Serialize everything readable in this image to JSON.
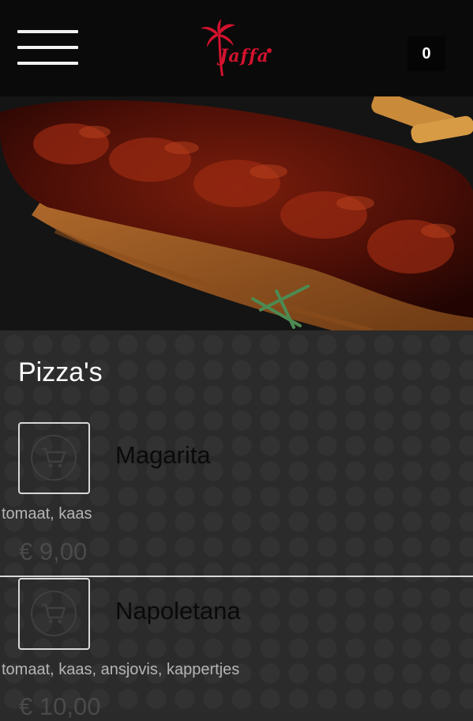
{
  "header": {
    "menu_icon": "hamburger-menu-icon",
    "logo_text": "Jaffa",
    "cart_count": "0"
  },
  "section": {
    "title": "Pizza's"
  },
  "items": [
    {
      "name": "Magarita",
      "description": "tomaat, kaas",
      "price": "€ 9,00",
      "icon": "cart-icon"
    },
    {
      "name": "Napoletana",
      "description": "tomaat, kaas, ansjovis, kappertjes",
      "price": "€ 10,00",
      "icon": "cart-icon"
    }
  ],
  "colors": {
    "brand": "#d2122e",
    "header_bg": "#0a0a0a",
    "content_bg": "#2b2b2b"
  }
}
